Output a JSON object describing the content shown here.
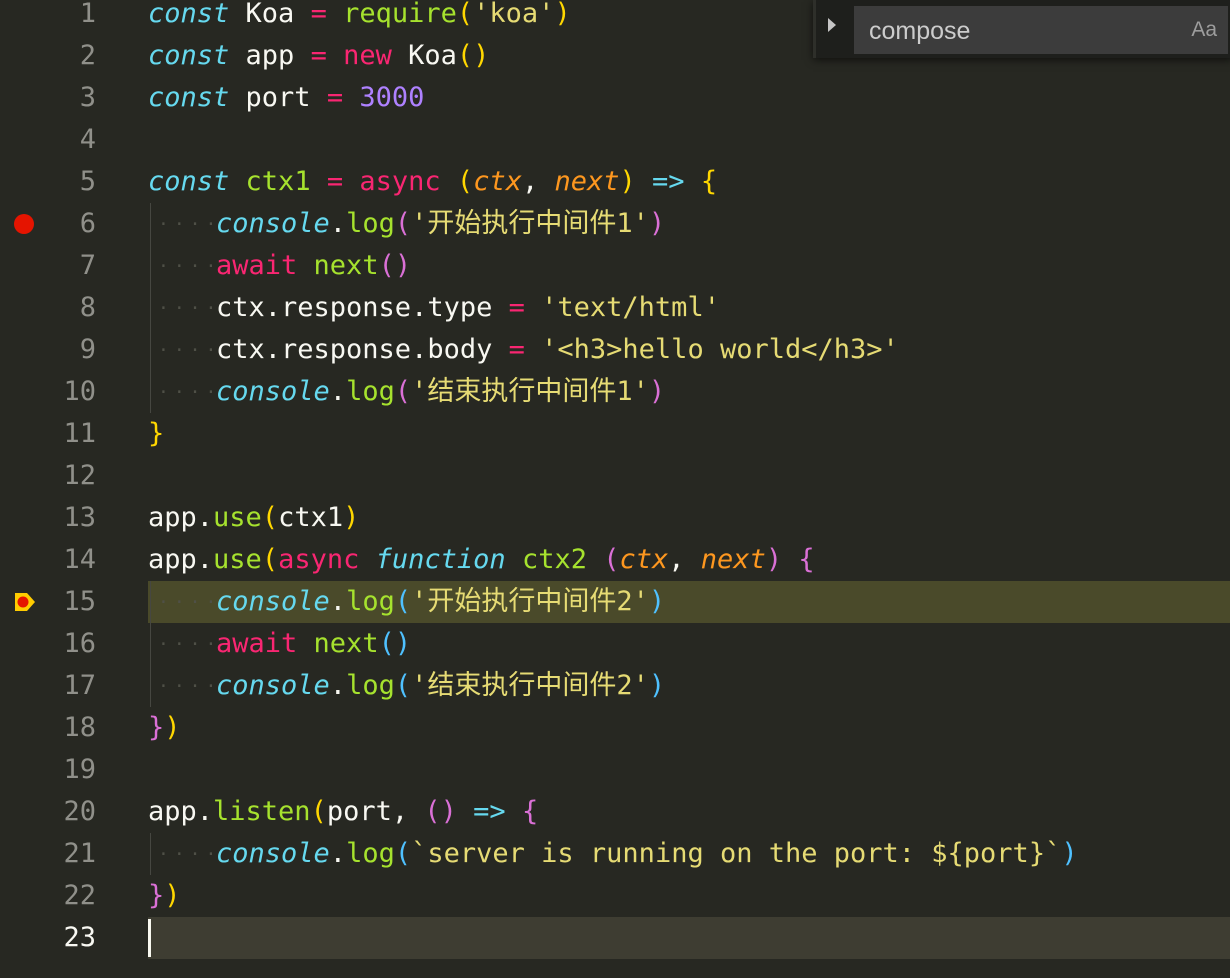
{
  "find_widget": {
    "query": "compose",
    "match_case_label": "Aa"
  },
  "editor": {
    "lines": [
      {
        "n": "1",
        "tokens": [
          [
            "kw-i",
            "const"
          ],
          [
            "plain",
            " Koa "
          ],
          [
            "op",
            "="
          ],
          [
            "plain",
            " "
          ],
          [
            "fn",
            "require"
          ],
          [
            "p-y",
            "("
          ],
          [
            "str",
            "'koa'"
          ],
          [
            "p-y",
            ")"
          ]
        ]
      },
      {
        "n": "2",
        "tokens": [
          [
            "kw-i",
            "const"
          ],
          [
            "plain",
            " app "
          ],
          [
            "op",
            "="
          ],
          [
            "plain",
            " "
          ],
          [
            "kw",
            "new"
          ],
          [
            "plain",
            " Koa"
          ],
          [
            "p-y",
            "()"
          ]
        ]
      },
      {
        "n": "3",
        "tokens": [
          [
            "kw-i",
            "const"
          ],
          [
            "plain",
            " port "
          ],
          [
            "op",
            "="
          ],
          [
            "plain",
            " "
          ],
          [
            "num",
            "3000"
          ]
        ]
      },
      {
        "n": "4",
        "tokens": []
      },
      {
        "n": "5",
        "tokens": [
          [
            "kw-i",
            "const"
          ],
          [
            "plain",
            " "
          ],
          [
            "fn",
            "ctx1"
          ],
          [
            "plain",
            " "
          ],
          [
            "op",
            "="
          ],
          [
            "plain",
            " "
          ],
          [
            "asyn",
            "async"
          ],
          [
            "plain",
            " "
          ],
          [
            "p-y",
            "("
          ],
          [
            "param",
            "ctx"
          ],
          [
            "plain",
            ", "
          ],
          [
            "param",
            "next"
          ],
          [
            "p-y",
            ")"
          ],
          [
            "plain",
            " "
          ],
          [
            "arrow",
            "=>"
          ],
          [
            "plain",
            " "
          ],
          [
            "p-y",
            "{"
          ]
        ]
      },
      {
        "n": "6",
        "indent": true,
        "bp": "dot",
        "tokens": [
          [
            "cons",
            "console"
          ],
          [
            "plain",
            "."
          ],
          [
            "fn",
            "log"
          ],
          [
            "p-m",
            "("
          ],
          [
            "str",
            "'开始执行中间件1'"
          ],
          [
            "p-m",
            ")"
          ]
        ]
      },
      {
        "n": "7",
        "indent": true,
        "tokens": [
          [
            "kw",
            "await"
          ],
          [
            "plain",
            " "
          ],
          [
            "fn",
            "next"
          ],
          [
            "p-m",
            "()"
          ]
        ]
      },
      {
        "n": "8",
        "indent": true,
        "tokens": [
          [
            "plain",
            "ctx.response.type "
          ],
          [
            "op",
            "="
          ],
          [
            "plain",
            " "
          ],
          [
            "str",
            "'text/html'"
          ]
        ]
      },
      {
        "n": "9",
        "indent": true,
        "tokens": [
          [
            "plain",
            "ctx.response.body "
          ],
          [
            "op",
            "="
          ],
          [
            "plain",
            " "
          ],
          [
            "str",
            "'<h3>hello world</h3>'"
          ]
        ]
      },
      {
        "n": "10",
        "indent": true,
        "tokens": [
          [
            "cons",
            "console"
          ],
          [
            "plain",
            "."
          ],
          [
            "fn",
            "log"
          ],
          [
            "p-m",
            "("
          ],
          [
            "str",
            "'结束执行中间件1'"
          ],
          [
            "p-m",
            ")"
          ]
        ]
      },
      {
        "n": "11",
        "tokens": [
          [
            "p-y",
            "}"
          ]
        ]
      },
      {
        "n": "12",
        "tokens": []
      },
      {
        "n": "13",
        "tokens": [
          [
            "plain",
            "app."
          ],
          [
            "fn",
            "use"
          ],
          [
            "p-y",
            "("
          ],
          [
            "plain",
            "ctx1"
          ],
          [
            "p-y",
            ")"
          ]
        ]
      },
      {
        "n": "14",
        "tokens": [
          [
            "plain",
            "app."
          ],
          [
            "fn",
            "use"
          ],
          [
            "p-y",
            "("
          ],
          [
            "asyn",
            "async"
          ],
          [
            "plain",
            " "
          ],
          [
            "kw-i",
            "function"
          ],
          [
            "plain",
            " "
          ],
          [
            "fn",
            "ctx2"
          ],
          [
            "plain",
            " "
          ],
          [
            "p-m",
            "("
          ],
          [
            "param",
            "ctx"
          ],
          [
            "plain",
            ", "
          ],
          [
            "param",
            "next"
          ],
          [
            "p-m",
            ")"
          ],
          [
            "plain",
            " "
          ],
          [
            "p-m",
            "{"
          ]
        ]
      },
      {
        "n": "15",
        "indent": true,
        "bp": "current",
        "hl": true,
        "tokens": [
          [
            "cons",
            "console"
          ],
          [
            "plain",
            "."
          ],
          [
            "fn",
            "log"
          ],
          [
            "p-b",
            "("
          ],
          [
            "str",
            "'开始执行中间件2'"
          ],
          [
            "p-b",
            ")"
          ]
        ]
      },
      {
        "n": "16",
        "indent": true,
        "tokens": [
          [
            "kw",
            "await"
          ],
          [
            "plain",
            " "
          ],
          [
            "fn",
            "next"
          ],
          [
            "p-b",
            "()"
          ]
        ]
      },
      {
        "n": "17",
        "indent": true,
        "tokens": [
          [
            "cons",
            "console"
          ],
          [
            "plain",
            "."
          ],
          [
            "fn",
            "log"
          ],
          [
            "p-b",
            "("
          ],
          [
            "str",
            "'结束执行中间件2'"
          ],
          [
            "p-b",
            ")"
          ]
        ]
      },
      {
        "n": "18",
        "tokens": [
          [
            "p-m",
            "}"
          ],
          [
            "p-y",
            ")"
          ]
        ]
      },
      {
        "n": "19",
        "tokens": []
      },
      {
        "n": "20",
        "tokens": [
          [
            "plain",
            "app."
          ],
          [
            "fn",
            "listen"
          ],
          [
            "p-y",
            "("
          ],
          [
            "plain",
            "port, "
          ],
          [
            "p-m",
            "()"
          ],
          [
            "plain",
            " "
          ],
          [
            "arrow",
            "=>"
          ],
          [
            "plain",
            " "
          ],
          [
            "p-m",
            "{"
          ]
        ]
      },
      {
        "n": "21",
        "indent": true,
        "tokens": [
          [
            "cons",
            "console"
          ],
          [
            "plain",
            "."
          ],
          [
            "fn",
            "log"
          ],
          [
            "p-b",
            "("
          ],
          [
            "str",
            "`server is running on the port: ${port}`"
          ],
          [
            "p-b",
            ")"
          ]
        ]
      },
      {
        "n": "22",
        "tokens": [
          [
            "p-m",
            "}"
          ],
          [
            "p-y",
            ")"
          ]
        ]
      },
      {
        "n": "23",
        "cur": true,
        "tokens": []
      }
    ]
  },
  "colors": {
    "background": "#272822",
    "breakpoint": "#e51400",
    "current_line_highlight": "#4a4a2a"
  }
}
